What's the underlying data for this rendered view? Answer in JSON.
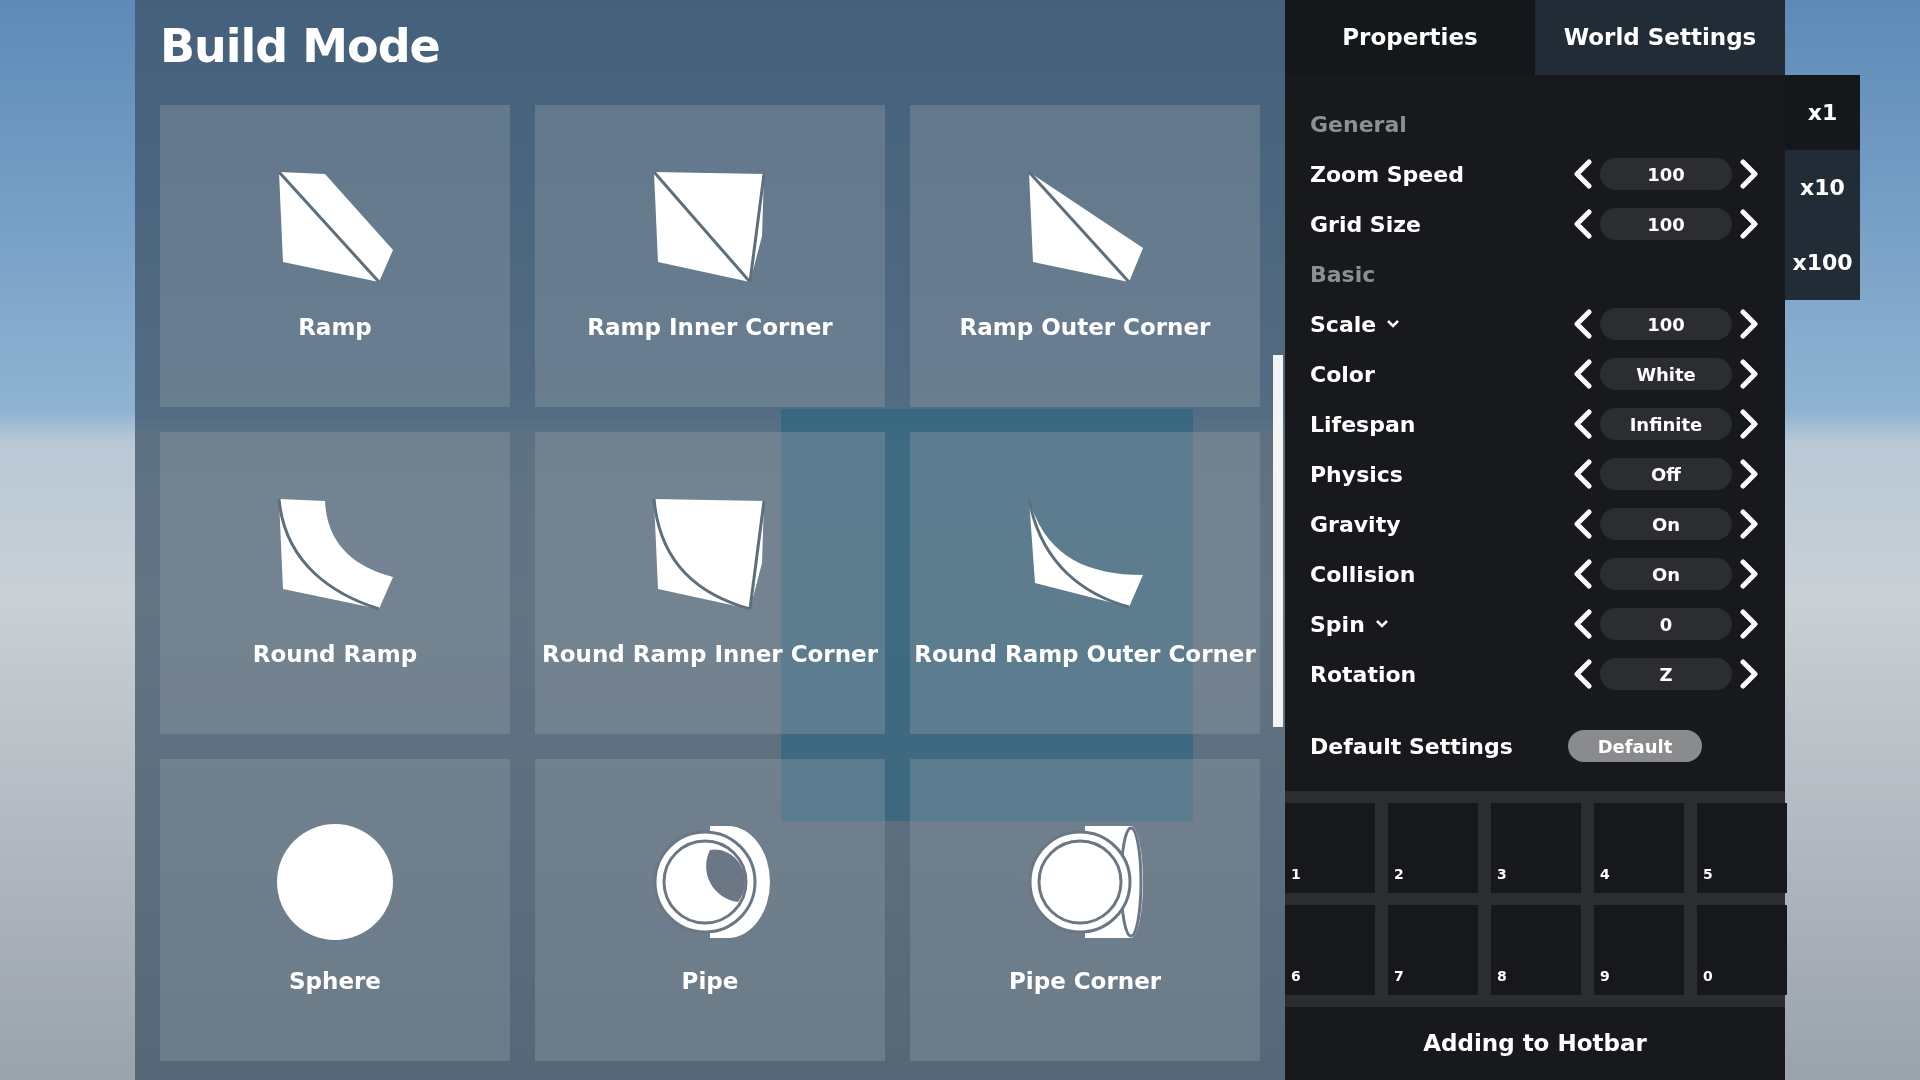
{
  "title": "Build Mode",
  "items": [
    {
      "label": "Ramp",
      "kind": "ramp"
    },
    {
      "label": "Ramp Inner Corner",
      "kind": "inner"
    },
    {
      "label": "Ramp Outer Corner",
      "kind": "outer"
    },
    {
      "label": "Round Ramp",
      "kind": "round"
    },
    {
      "label": "Round Ramp Inner Corner",
      "kind": "roundinner"
    },
    {
      "label": "Round Ramp Outer Corner",
      "kind": "roundouter"
    },
    {
      "label": "Sphere",
      "kind": "sphere"
    },
    {
      "label": "Pipe",
      "kind": "pipe"
    },
    {
      "label": "Pipe Corner",
      "kind": "pipecorner"
    }
  ],
  "tabs": [
    {
      "label": "Properties",
      "selected": true
    },
    {
      "label": "World Settings",
      "selected": false
    }
  ],
  "multipliers": [
    {
      "label": "x1",
      "selected": true
    },
    {
      "label": "x10",
      "selected": false
    },
    {
      "label": "x100",
      "selected": false
    }
  ],
  "settings": [
    {
      "kind": "heading",
      "label": "General"
    },
    {
      "kind": "stepper",
      "label": "Zoom Speed",
      "value": "100",
      "dropdown": false
    },
    {
      "kind": "stepper",
      "label": "Grid Size",
      "value": "100",
      "dropdown": false
    },
    {
      "kind": "heading",
      "label": "Basic"
    },
    {
      "kind": "stepper",
      "label": "Scale",
      "value": "100",
      "dropdown": true
    },
    {
      "kind": "stepper",
      "label": "Color",
      "value": "White",
      "dropdown": false
    },
    {
      "kind": "stepper",
      "label": "Lifespan",
      "value": "Infinite",
      "dropdown": false
    },
    {
      "kind": "stepper",
      "label": "Physics",
      "value": "Off",
      "dropdown": false
    },
    {
      "kind": "stepper",
      "label": "Gravity",
      "value": "On",
      "dropdown": false
    },
    {
      "kind": "stepper",
      "label": "Collision",
      "value": "On",
      "dropdown": false
    },
    {
      "kind": "stepper",
      "label": "Spin",
      "value": "0",
      "dropdown": true
    },
    {
      "kind": "stepper",
      "label": "Rotation",
      "value": "Z",
      "dropdown": false
    }
  ],
  "defaults": {
    "label": "Default Settings",
    "button": "Default"
  },
  "hotbar": {
    "slots": [
      "1",
      "2",
      "3",
      "4",
      "5",
      "6",
      "7",
      "8",
      "9",
      "0"
    ],
    "caption": "Adding to Hotbar"
  }
}
